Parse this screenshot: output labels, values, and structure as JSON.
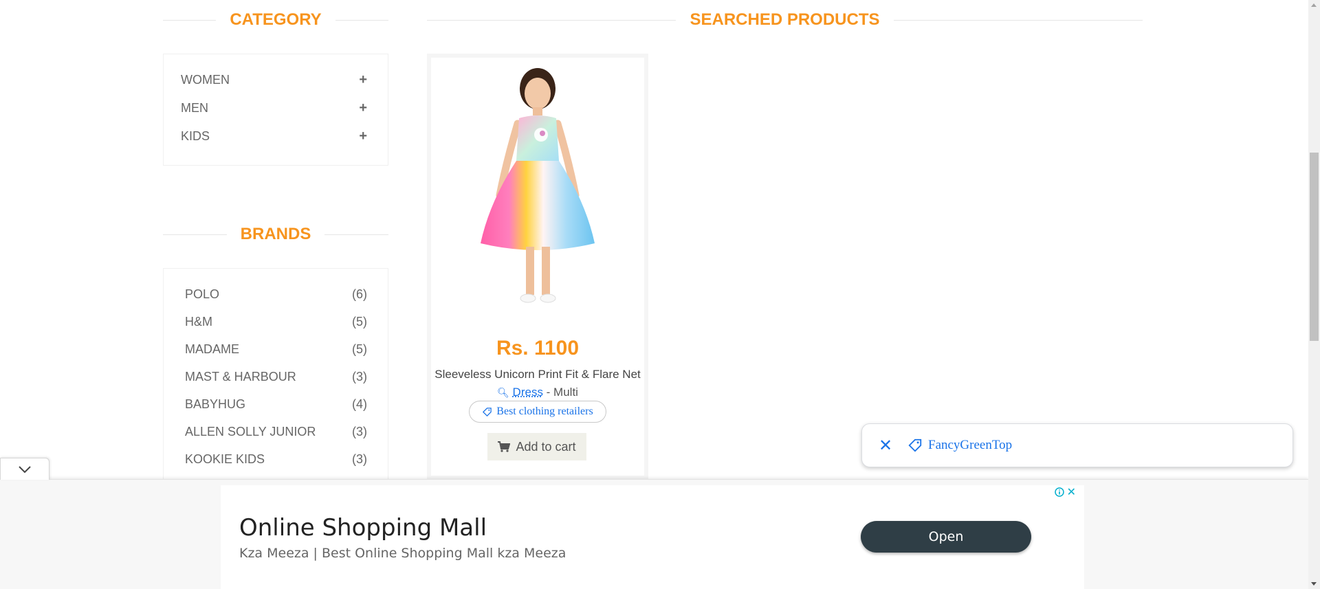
{
  "category": {
    "title": "CATEGORY",
    "items": [
      {
        "label": "WOMEN",
        "toggle": "+"
      },
      {
        "label": "MEN",
        "toggle": "+"
      },
      {
        "label": "KIDS",
        "toggle": "+"
      }
    ]
  },
  "brands": {
    "title": "BRANDS",
    "items": [
      {
        "label": "POLO",
        "count": "(6)"
      },
      {
        "label": "H&M",
        "count": "(5)"
      },
      {
        "label": "MADAME",
        "count": "(5)"
      },
      {
        "label": "MAST & HARBOUR",
        "count": "(3)"
      },
      {
        "label": "BABYHUG",
        "count": "(4)"
      },
      {
        "label": "ALLEN SOLLY JUNIOR",
        "count": "(3)"
      },
      {
        "label": "KOOKIE KIDS",
        "count": "(3)"
      }
    ]
  },
  "products": {
    "title": "SEARCHED PRODUCTS",
    "items": [
      {
        "price": "Rs. 1100",
        "name": "Sleeveless Unicorn Print Fit & Flare Net",
        "keyword": "Dress",
        "suffix": " - Multi",
        "chip": "Best clothing retailers",
        "add_to_cart": "Add to cart"
      }
    ]
  },
  "floating_tag": {
    "label": "FancyGreenTop"
  },
  "ad": {
    "title": "Online Shopping Mall",
    "subtitle": "Kza Meeza | Best Online Shopping Mall kza Meeza",
    "button": "Open"
  },
  "colors": {
    "accent": "#f7941e",
    "link": "#1a73e8",
    "ad_button": "#2f3e46"
  }
}
